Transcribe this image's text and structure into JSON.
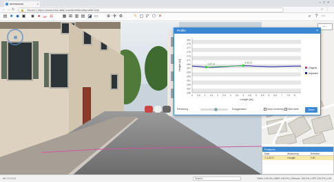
{
  "browser": {
    "tab_title": "streetsmart",
    "url": "Secure | https://www.infra-data.com/streetsmart/profile.html",
    "secure_label": "Secure"
  },
  "profile": {
    "title": "Profile",
    "close": "×",
    "height_label": "Height [m]",
    "length_label": "Length [m]",
    "footer_left": "Rendering",
    "footer_mid": "Exaggeration",
    "footer_check1": "Keep rendering",
    "footer_check2": "Hide table",
    "ok_label": "Save",
    "legend": [
      "Original",
      "Adjusted"
    ]
  },
  "feature_table": {
    "title": "Features",
    "columns": [
      "Date",
      "Measuring",
      "Direction"
    ],
    "row": [
      "7-1-2017",
      "Hoogte",
      "0.00"
    ]
  },
  "status": {
    "left": "ref: 17.4.0.3",
    "search_placeholder": "Search...",
    "right": "Cities: 100.0% | MMS 100.0% | Gebouw: 100.0% | GPS 100.0% | LIM"
  },
  "chart_data": {
    "type": "line",
    "title": "",
    "xlabel": "Length [m]",
    "ylabel": "Height [m]",
    "xlim": [
      0,
      8.5
    ],
    "ylim": [
      255,
      282
    ],
    "x_ticks": [
      0,
      0.5,
      1,
      1.5,
      2,
      2.5,
      3,
      3.5,
      4,
      4.5,
      5,
      5.5,
      6,
      6.5,
      7,
      7.5,
      8
    ],
    "y_ticks": [
      255,
      257,
      259,
      261,
      263,
      265,
      267,
      269,
      271,
      273,
      275,
      277,
      279,
      281
    ],
    "series": [
      {
        "name": "Original",
        "color": "#1a1aa8",
        "x": [
          0,
          0.5,
          1,
          1.5,
          2,
          2.5,
          3,
          3.5,
          4,
          4.5,
          5,
          5.5,
          6,
          6.5,
          7,
          7.5,
          8,
          8.5
        ],
        "y": [
          268.1,
          267.9,
          267.6,
          267.5,
          267.6,
          267.8,
          268.0,
          268.2,
          268.3,
          268.2,
          268.0,
          267.9,
          267.8,
          267.8,
          267.9,
          268.0,
          268.1,
          268.1
        ]
      }
    ],
    "markers": [
      {
        "x": 1.1,
        "y": 267.6,
        "label": "1.67 m"
      },
      {
        "x": 4.0,
        "y": 268.3,
        "label": "3.93 m"
      }
    ],
    "legend_position": "right"
  },
  "colors": {
    "accent": "#3a87d4",
    "series": "#1a1aa8",
    "marker": "#3ec93e",
    "legend_original": "#d03070",
    "legend_adjusted": "#1a1aa8"
  }
}
